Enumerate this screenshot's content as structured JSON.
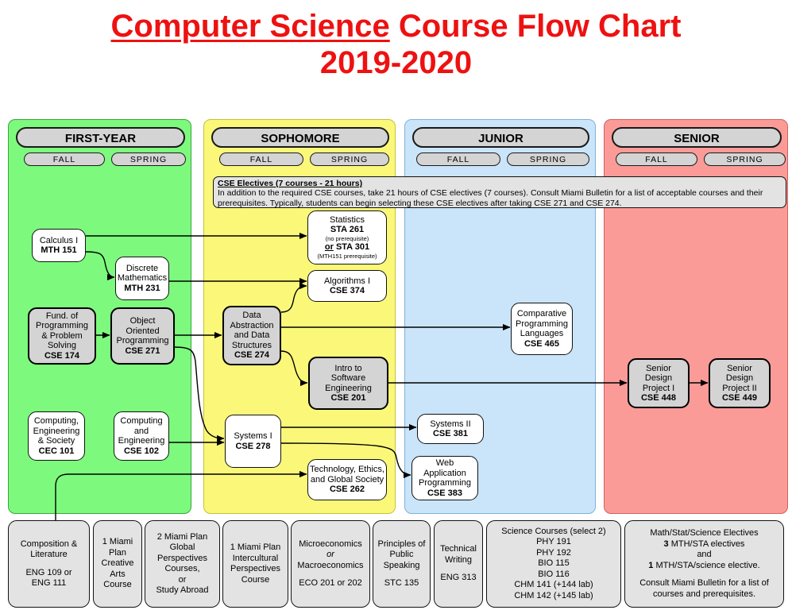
{
  "title": {
    "line1_underlined": "Computer Science",
    "line1_rest": " Course Flow Chart",
    "line2": "2019-2020",
    "color": "#ee1111"
  },
  "columns": [
    {
      "id": "first-year",
      "label": "FIRST-YEAR",
      "color": "#7dfa7d",
      "fall": "FALL",
      "spring": "SPRING"
    },
    {
      "id": "sophomore",
      "label": "SOPHOMORE",
      "color": "#fbf879",
      "fall": "FALL",
      "spring": "SPRING"
    },
    {
      "id": "junior",
      "label": "JUNIOR",
      "color": "#cae5fa",
      "fall": "FALL",
      "spring": "SPRING"
    },
    {
      "id": "senior",
      "label": "SENIOR",
      "color": "#fb9b98",
      "fall": "FALL",
      "spring": "SPRING"
    }
  ],
  "electives_note": {
    "title": "CSE Electives (7 courses - 21 hours)",
    "body": "In addition to the required CSE courses, take 21 hours of CSE electives (7 courses). Consult Miami Bulletin for a list of acceptable courses and their prerequisites. Typically, students can begin selecting these CSE electives after taking CSE 271 and CSE 274."
  },
  "courses": {
    "mth151": {
      "name": "Calculus I",
      "code": "MTH 151"
    },
    "mth231": {
      "name_l1": "Discrete",
      "name_l2": "Mathematics",
      "code": "MTH 231"
    },
    "cse174": {
      "name_l1": "Fund. of",
      "name_l2": "Programming",
      "name_l3": "& Problem",
      "name_l4": "Solving",
      "code": "CSE 174"
    },
    "cse271": {
      "name_l1": "Object",
      "name_l2": "Oriented",
      "name_l3": "Programming",
      "code": "CSE 271"
    },
    "cec101": {
      "name_l1": "Computing,",
      "name_l2": "Engineering",
      "name_l3": "& Society",
      "code": "CEC 101"
    },
    "cse102": {
      "name_l1": "Computing",
      "name_l2": "and",
      "name_l3": "Engineering",
      "code": "CSE 102"
    },
    "sta261": {
      "name": "Statistics",
      "code": "STA 261",
      "note1": "(no prerequisite)",
      "or_label": "or",
      "alt_code": "STA 301",
      "note2": "(MTH151 prerequisite)"
    },
    "cse374": {
      "name": "Algorithms I",
      "code": "CSE 374"
    },
    "cse274": {
      "name_l1": "Data",
      "name_l2": "Abstraction",
      "name_l3": "and Data",
      "name_l4": "Structures",
      "code": "CSE 274"
    },
    "cse201": {
      "name_l1": "Intro to",
      "name_l2": "Software",
      "name_l3": "Engineering",
      "code": "CSE 201"
    },
    "cse278": {
      "name": "Systems I",
      "code": "CSE 278"
    },
    "cse262": {
      "name_l1": "Technology, Ethics,",
      "name_l2": "and Global Society",
      "code": "CSE 262"
    },
    "cse465": {
      "name_l1": "Comparative",
      "name_l2": "Programming",
      "name_l3": "Languages",
      "code": "CSE 465"
    },
    "cse381": {
      "name": "Systems II",
      "code": "CSE 381"
    },
    "cse383": {
      "name_l1": "Web",
      "name_l2": "Application",
      "name_l3": "Programming",
      "code": "CSE 383"
    },
    "cse448": {
      "name_l1": "Senior",
      "name_l2": "Design",
      "name_l3": "Project I",
      "code": "CSE 448"
    },
    "cse449": {
      "name_l1": "Senior",
      "name_l2": "Design",
      "name_l3": "Project II",
      "code": "CSE 449"
    }
  },
  "general_boxes": {
    "composition": {
      "l1": "Composition &",
      "l2": "Literature",
      "l3": "ENG 109 or",
      "l4": "ENG 111"
    },
    "creative_arts": {
      "l1": "1 Miami",
      "l2": "Plan",
      "l3": "Creative",
      "l4": "Arts Course"
    },
    "global": {
      "l1": "2 Miami Plan",
      "l2": "Global",
      "l3": "Perspectives",
      "l4": "Courses,",
      "l5": "or",
      "l6": "Study Abroad"
    },
    "intercultural": {
      "l1": "1 Miami Plan",
      "l2": "Intercultural",
      "l3": "Perspectives",
      "l4": "Course"
    },
    "economics": {
      "l1": "Microeconomics",
      "l2": "or",
      "l3": "Macroeconomics",
      "l4": "ECO 201 or 202"
    },
    "speaking": {
      "l1": "Principles of",
      "l2": "Public",
      "l3": "Speaking",
      "l4": "STC 135"
    },
    "writing": {
      "l1": "Technical",
      "l2": "Writing",
      "l3": "ENG 313"
    },
    "science": {
      "title": "Science Courses (select 2)",
      "items": [
        "PHY 191",
        "PHY 192",
        "BIO 115",
        "BIO 116",
        "CHM 141 (+144 lab)",
        "CHM 142 (+145 lab)"
      ]
    },
    "mathstat": {
      "l1": "Math/Stat/Science Electives",
      "l2_bold": "3",
      "l2_rest": " MTH/STA electives",
      "l3": "and",
      "l4_bold": "1",
      "l4_rest": " MTH/STA/science elective.",
      "l5": "Consult Miami Bulletin for a list of",
      "l6": "courses and prerequisites."
    }
  }
}
